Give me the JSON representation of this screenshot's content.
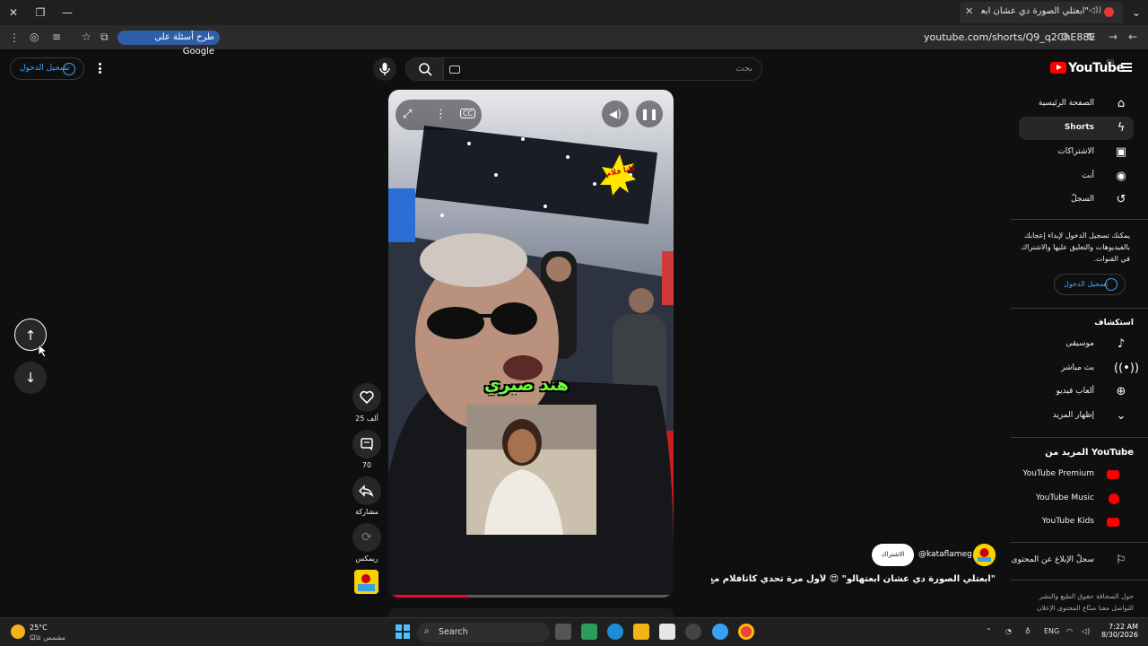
{
  "browser": {
    "tab_title": "\"ابعتلي الصورة دي عشان ابعـ",
    "url": "youtube.com/shorts/Q9_q2ChE88E",
    "google_pill": "طرح أسئلة على Google"
  },
  "header": {
    "logo": "YouTube",
    "country": "EG",
    "search_placeholder": "بحث",
    "signin": "تسجيل الدخول"
  },
  "sidebar": {
    "items": [
      {
        "label": "الصفحة الرئيسية",
        "icon": "home-icon"
      },
      {
        "label": "Shorts",
        "icon": "shorts-icon"
      },
      {
        "label": "الاشتراكات",
        "icon": "subscriptions-icon"
      },
      {
        "label": "أنت",
        "icon": "you-icon"
      },
      {
        "label": "السجلّ",
        "icon": "history-icon"
      }
    ],
    "signin_prompt": "يمكنك تسجيل الدخول لإبداء إعجابك بالفيديوهات والتعليق عليها والاشتراك في القنوات.",
    "signin": "تسجيل الدخول",
    "explore_title": "استكشاف",
    "explore": [
      {
        "label": "موسيقى",
        "icon": "music-icon"
      },
      {
        "label": "بث مباشر",
        "icon": "live-icon"
      },
      {
        "label": "ألعاب فيديو",
        "icon": "gaming-icon"
      },
      {
        "label": "إظهار المزيد",
        "icon": "chevron-down-icon"
      }
    ],
    "more_title": "المزيد من YouTube",
    "more": [
      {
        "label": "YouTube Premium"
      },
      {
        "label": "YouTube Music"
      },
      {
        "label": "YouTube Kids"
      }
    ],
    "report": "سجلّ الإبلاغ عن المحتوى",
    "footer_1": "حول  الصحافة  حقوق الطبع والنشر",
    "footer_2": "التواصل معنا  صنّاع المحتوى  الإعلان"
  },
  "short": {
    "overlay_name": "هند صبري",
    "likes": "25 ألف",
    "comments": "70",
    "share": "مشاركة",
    "remix": "ريمكس",
    "channel": "@kataflameg",
    "subscribe": "الاشتراك",
    "title": "\"ابعتلي الصورة دي عشان ابعتهالو\" 😍 لأول مرة تحدي كاتافلام مع أحمد...",
    "progress": 0.28,
    "sticker": "كاتا فلام"
  },
  "taskbar": {
    "temp": "25°C",
    "weather": "مشمس غالبًا",
    "search": "Search",
    "lang": "ENG",
    "time": "7:22 AM",
    "date": "8/30/2026"
  },
  "colors": {
    "accent_blue": "#3ea6ff",
    "brand_red": "#ff0000",
    "overlay_green": "#6bff3a"
  }
}
